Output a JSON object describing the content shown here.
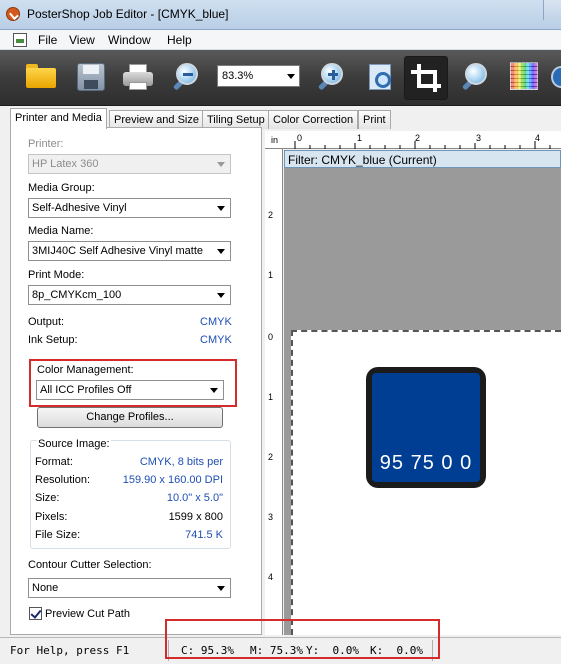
{
  "window": {
    "title": "PosterShop Job Editor - [CMYK_blue]"
  },
  "menu": {
    "items": [
      "File",
      "View",
      "Window",
      "Help"
    ]
  },
  "toolbar": {
    "zoom_value": "83.3%"
  },
  "tabs": [
    "Printer and Media",
    "Preview and Size",
    "Tiling Setup",
    "Color Correction",
    "Print"
  ],
  "printer": {
    "label": "Printer:",
    "value": "HP Latex 360"
  },
  "media_group": {
    "label": "Media Group:",
    "value": "Self-Adhesive Vinyl"
  },
  "media_name": {
    "label": "Media Name:",
    "value": "3MIJ40C Self Adhesive Vinyl matte"
  },
  "print_mode": {
    "label": "Print Mode:",
    "value": "8p_CMYKcm_100"
  },
  "output": {
    "label": "Output:",
    "value": "CMYK"
  },
  "ink_setup": {
    "label": "Ink Setup:",
    "value": "CMYK"
  },
  "color_management": {
    "label": "Color Management:",
    "value": "All ICC Profiles Off",
    "button": "Change Profiles..."
  },
  "source_image": {
    "title": "Source Image:",
    "rows": [
      {
        "label": "Format:",
        "value": "CMYK, 8 bits per"
      },
      {
        "label": "Resolution:",
        "value": "159.90 x 160.00 DPI"
      },
      {
        "label": "Size:",
        "value": "10.0\" x 5.0\""
      },
      {
        "label": "Pixels:",
        "value": "1599 x 800"
      },
      {
        "label": "File Size:",
        "value": "741.5 K"
      }
    ]
  },
  "contour_cutter": {
    "label": "Contour Cutter Selection:",
    "value": "None"
  },
  "preview_cut_path": {
    "label": "Preview Cut Path",
    "checked": true
  },
  "preview": {
    "filter_label": "Filter: CMYK_blue (Current)",
    "ruler_unit": "in",
    "ruler_top": [
      "0",
      "1",
      "2",
      "3",
      "4"
    ],
    "ruler_left": [
      "2",
      "1",
      "0",
      "1",
      "2",
      "3",
      "4"
    ],
    "swatch_text": "95 75 0 0",
    "swatch_color": "#003e93"
  },
  "status": {
    "help": "For Help, press F1",
    "c": "C: 95.3%",
    "m": "M: 75.3%",
    "y": "Y:  0.0%",
    "k": "K:  0.0%"
  },
  "colors": {
    "highlight": "#d42b2b",
    "value_blue": "#1f4eb4"
  }
}
